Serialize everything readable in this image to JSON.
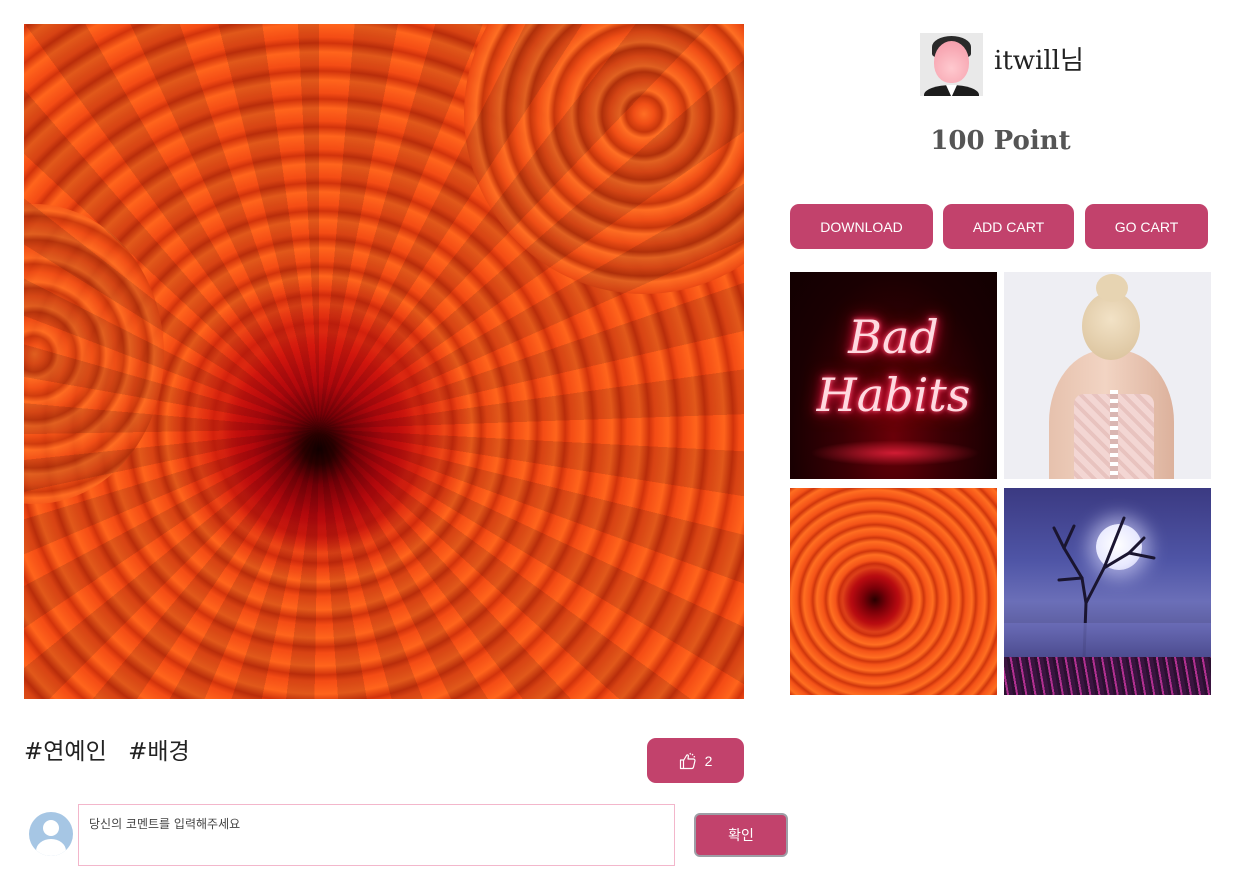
{
  "profile": {
    "username": "itwill님",
    "points": "100 Point"
  },
  "actions": {
    "download_label": "DOWNLOAD",
    "add_cart_label": "ADD CART",
    "go_cart_label": "GO CART"
  },
  "thumbnails": {
    "neon_line1": "Bad",
    "neon_line2": "Habits"
  },
  "tags": [
    "#연예인",
    "#배경"
  ],
  "like": {
    "icon": "thumbs-up-icon",
    "count": "2"
  },
  "comment": {
    "placeholder": "당신의 코멘트를 입력해주세요",
    "submit_label": "확인"
  },
  "colors": {
    "accent": "#c2426c",
    "comment_border": "#f3b6cb"
  }
}
